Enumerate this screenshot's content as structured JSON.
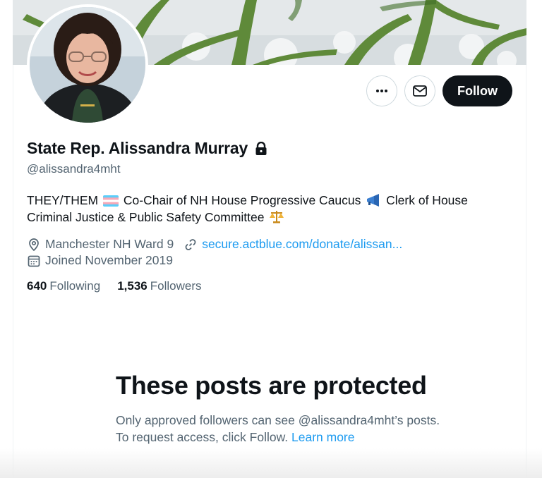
{
  "profile": {
    "display_name": "State Rep. Alissandra Murray",
    "handle": "@alissandra4mht",
    "bio_line1_a": "THEY/THEM",
    "bio_line1_b": "Co-Chair of NH House Progressive Caucus",
    "bio_line1_c": "Clerk of House",
    "bio_line2": "Criminal Justice & Public Safety Committee",
    "location": "Manchester NH Ward 9",
    "website": "secure.actblue.com/donate/alissan...",
    "joined": "Joined November 2019",
    "following_count": "640",
    "following_label": "Following",
    "followers_count": "1,536",
    "followers_label": "Followers"
  },
  "actions": {
    "follow_label": "Follow"
  },
  "protected": {
    "title": "These posts are protected",
    "text": "Only approved followers can see @alissandra4mht’s posts. To request access, click Follow.",
    "learn_more": "Learn more"
  },
  "icons": {
    "more": "more-icon",
    "message": "envelope-icon",
    "lock": "lock-icon",
    "location": "location-pin-icon",
    "link": "link-icon",
    "calendar": "calendar-icon"
  },
  "colors": {
    "accent": "#1d9bf0",
    "follow_button": "#0f1419",
    "secondary_text": "#536471"
  }
}
